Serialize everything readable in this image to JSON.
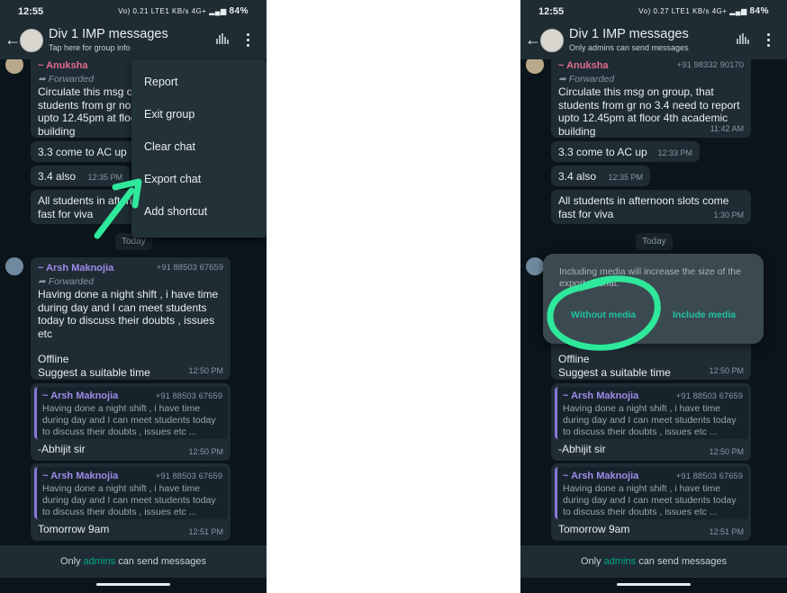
{
  "status_bar": {
    "time": "12:55",
    "signal_left": "Vo) 0.21 LTE1 KB/s",
    "signal_right": "Vo) 0.27 LTE1 KB/s",
    "network": "4G+",
    "battery": "84%"
  },
  "header": {
    "title": "Div 1 IMP messages",
    "subtitle_left": "Tap here for group info",
    "subtitle_right": "Only admins can send messages"
  },
  "menu": {
    "items": [
      "Report",
      "Exit group",
      "Clear chat",
      "Export chat",
      "Add shortcut"
    ]
  },
  "export_dialog": {
    "message": "Including media will increase the size of the exported chat.",
    "without_media": "Without media",
    "include_media": "Include media"
  },
  "messages": {
    "m1": {
      "sender": "~ Anuksha",
      "phone": "+91 98332 90170",
      "forwarded": "Forwarded",
      "text_lines": [
        "Circulate this msg on group, that",
        "students from gr no 3.4 need to report",
        "upto 12.45pm at floor 4th academic",
        "building"
      ],
      "time": "11:42 AM"
    },
    "m2": {
      "text": "3.3 come to AC up",
      "time": "12:33 PM"
    },
    "m3": {
      "text": "3.4 also",
      "time": "12:35 PM"
    },
    "m4": {
      "text_lines": [
        "All students in afternoon slots come",
        "fast for viva"
      ],
      "time": "1:30 PM"
    },
    "date_chip": "Today",
    "m5": {
      "sender": "~ Arsh Maknojia",
      "phone": "+91 88503 67659",
      "forwarded": "Forwarded",
      "text_lines": [
        "Having done a night shift , i have time",
        "during day and I can meet students",
        "today to discuss their doubts , issues",
        "etc"
      ],
      "extra_lines": [
        "Offline",
        "Suggest a suitable time"
      ],
      "time": "12:50 PM"
    },
    "m6": {
      "quote_sender": "~ Arsh Maknojia",
      "quote_phone": "+91 88503 67659",
      "quote_lines": [
        "Having done a night shift , i have time",
        "during day and I can meet students today",
        "to discuss their doubts , issues etc ..."
      ],
      "text": "-Abhijit sir",
      "time": "12:50 PM"
    },
    "m7": {
      "quote_sender": "~ Arsh Maknojia",
      "quote_phone": "+91 88503 67659",
      "quote_lines": [
        "Having done a night shift , i have time",
        "during day and I can meet students today",
        "to discuss their doubts , issues etc ..."
      ],
      "text": "Tomorrow 9am",
      "time": "12:51 PM"
    }
  },
  "footer": {
    "prefix": "Only",
    "accent": "admins",
    "suffix": "can send messages"
  },
  "colors": {
    "bg": "#0b141a",
    "bubble": "#1f2c34",
    "accent": "#00a884",
    "annotation": "#2ee89c"
  },
  "icons": [
    "back-arrow-icon",
    "voice-wave-icon",
    "more-vert-icon",
    "forward-icon"
  ]
}
